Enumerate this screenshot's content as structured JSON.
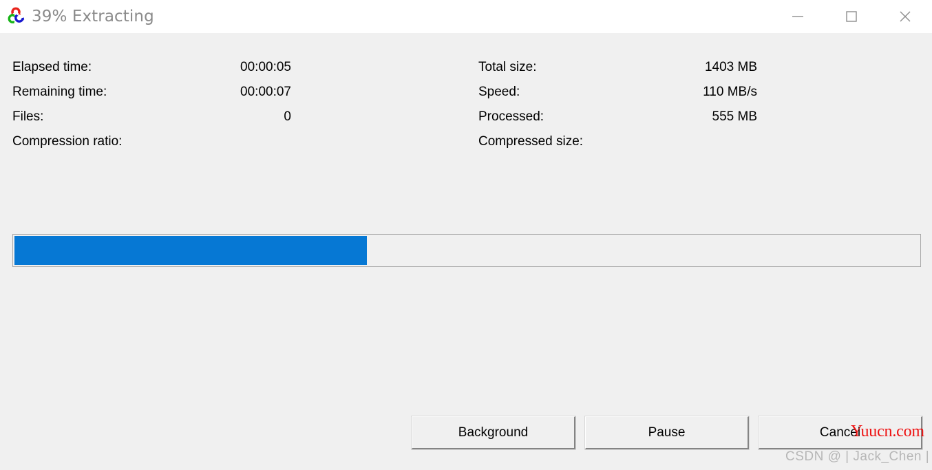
{
  "window": {
    "title": "39% Extracting",
    "icon": "sevenzip-logo-icon",
    "controls": {
      "minimize": "Minimize",
      "maximize": "Maximize",
      "close": "Close"
    }
  },
  "progress": {
    "percent": 39,
    "fill_color": "#0678d4",
    "track_color": "#f0f0f0",
    "border_color": "#a8a8a8"
  },
  "stats": {
    "left": [
      {
        "label": "Elapsed time:",
        "value": "00:00:05"
      },
      {
        "label": "Remaining time:",
        "value": "00:00:07"
      },
      {
        "label": "Files:",
        "value": "0"
      },
      {
        "label": "Compression ratio:",
        "value": ""
      }
    ],
    "right": [
      {
        "label": "Total size:",
        "value": "1403 MB"
      },
      {
        "label": "Speed:",
        "value": "110 MB/s"
      },
      {
        "label": "Processed:",
        "value": "555 MB"
      },
      {
        "label": "Compressed size:",
        "value": ""
      }
    ]
  },
  "buttons": {
    "background": "Background",
    "pause": "Pause",
    "cancel": "Cancel"
  },
  "watermarks": {
    "red": "Yuucn.com",
    "csdn": "CSDN @ | Jack_Chen |"
  }
}
